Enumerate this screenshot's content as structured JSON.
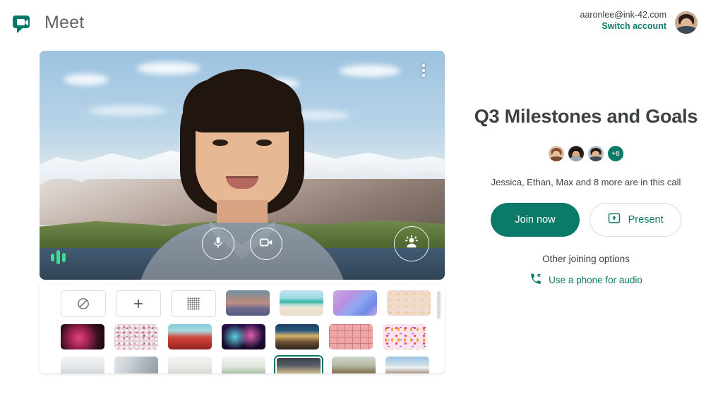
{
  "header": {
    "brand_name": "Meet",
    "logo_icon": "meet-video-bubble-icon",
    "account_email": "aaronlee@ink-42.com",
    "switch_account_label": "Switch account",
    "avatar_icon": "account-avatar"
  },
  "preview": {
    "more_options_icon": "more-vert-icon",
    "mic_icon": "microphone-icon",
    "camera_icon": "video-camera-icon",
    "effects_icon": "visual-effects-icon",
    "audio_meter_icon": "audio-level-icon",
    "background_applied": "mountains"
  },
  "background_panel": {
    "no_effect_label": "no-effect",
    "add_label": "+",
    "blur_label": "blur",
    "selected_index": 18,
    "rows": [
      [
        {
          "name": "no-effect-button",
          "kind": "button",
          "art": "none"
        },
        {
          "name": "add-background-button",
          "kind": "button",
          "art": "add"
        },
        {
          "name": "blur-background-button",
          "kind": "button",
          "art": "blur"
        },
        {
          "name": "background-dusk",
          "kind": "image",
          "art": "t-dusk"
        },
        {
          "name": "background-beach",
          "kind": "image",
          "art": "t-beach"
        },
        {
          "name": "background-clouds",
          "kind": "image",
          "art": "t-clouds"
        },
        {
          "name": "background-confetti-gold",
          "kind": "image",
          "art": "t-confetti"
        }
      ],
      [
        {
          "name": "background-nebula",
          "kind": "image",
          "art": "t-nebula"
        },
        {
          "name": "background-blossom",
          "kind": "image",
          "art": "t-blossom"
        },
        {
          "name": "background-red-flowers",
          "kind": "image",
          "art": "t-redflowers"
        },
        {
          "name": "background-fireworks",
          "kind": "image",
          "art": "t-fireworks"
        },
        {
          "name": "background-patio",
          "kind": "image",
          "art": "t-patio"
        },
        {
          "name": "background-pink-grid",
          "kind": "image",
          "art": "t-grid"
        },
        {
          "name": "background-party-confetti",
          "kind": "image",
          "art": "t-party"
        }
      ],
      [
        {
          "name": "background-office-light",
          "kind": "image",
          "art": "t-office1"
        },
        {
          "name": "background-office-stairs",
          "kind": "image",
          "art": "t-office2"
        },
        {
          "name": "background-living-room",
          "kind": "image",
          "art": "t-livingroom"
        },
        {
          "name": "background-plants-room",
          "kind": "image",
          "art": "t-plants"
        },
        {
          "name": "background-shelves",
          "kind": "image",
          "art": "t-shelves"
        },
        {
          "name": "background-horses",
          "kind": "image",
          "art": "t-horses"
        },
        {
          "name": "background-mountains",
          "kind": "image",
          "art": "t-mountains"
        }
      ]
    ]
  },
  "meeting": {
    "title": "Q3 Milestones and Goals",
    "participants_extra": "+8",
    "participants_text": "Jessica, Ethan, Max and 8 more are in this call",
    "join_label": "Join now",
    "present_label": "Present",
    "present_icon": "present-screen-icon",
    "other_options_label": "Other joining options",
    "phone_audio_label": "Use a phone for audio",
    "phone_icon": "dial-in-phone-icon"
  },
  "colors": {
    "brand_teal": "#0b7a68",
    "text_primary": "#3c4043",
    "text_secondary": "#5f6368",
    "audio_green": "#3ddc97"
  }
}
